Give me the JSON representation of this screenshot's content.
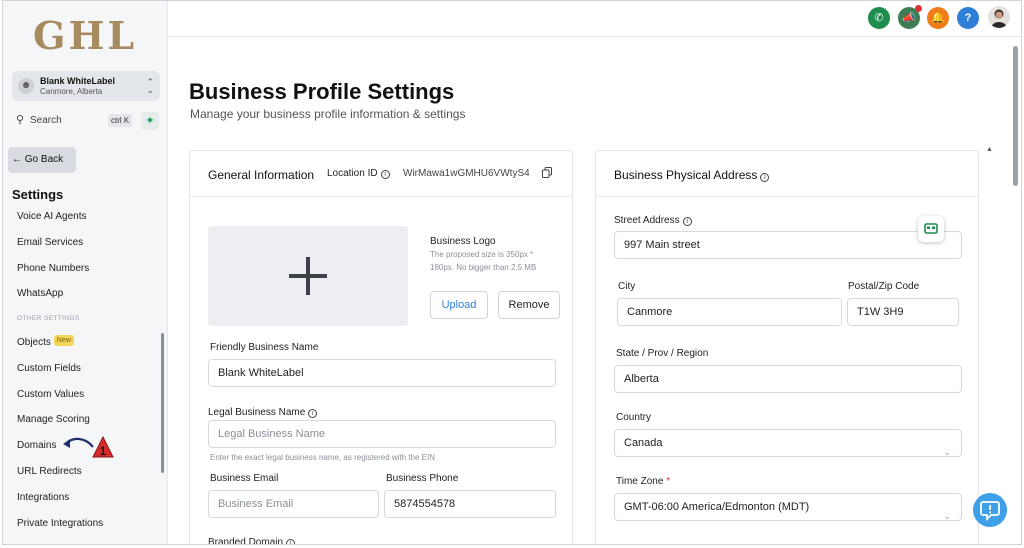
{
  "sidebar": {
    "logo_text": "GHL",
    "account": {
      "name": "Blank WhiteLabel",
      "location": "Canmore, Alberta"
    },
    "search": {
      "label": "Search",
      "shortcut": "ctrl K"
    },
    "go_back": "← Go Back",
    "settings_title": "Settings",
    "items": [
      "Voice AI Agents",
      "Email Services",
      "Phone Numbers",
      "WhatsApp"
    ],
    "other_section_label": "OTHER SETTINGS",
    "other_items": [
      {
        "label": "Objects",
        "badge": "New"
      },
      {
        "label": "Custom Fields"
      },
      {
        "label": "Custom Values"
      },
      {
        "label": "Manage Scoring"
      },
      {
        "label": "Domains"
      },
      {
        "label": "URL Redirects"
      },
      {
        "label": "Integrations"
      },
      {
        "label": "Private Integrations"
      }
    ],
    "callout_number": "1"
  },
  "topbar": {
    "icons": [
      "phone-icon",
      "megaphone-icon",
      "bell-icon",
      "help-icon",
      "user-avatar"
    ],
    "help_label": "?"
  },
  "page": {
    "title": "Business Profile Settings",
    "subtitle": "Manage your business profile information & settings"
  },
  "general": {
    "title": "General Information",
    "location_id_label": "Location ID",
    "location_id_value": "WirMawa1wGMHU6VWtyS4",
    "logo_label": "Business Logo",
    "logo_hint_1": "The proposed size is 350px *",
    "logo_hint_2": "180px. No bigger than 2.5 MB",
    "upload_button": "Upload",
    "remove_button": "Remove",
    "friendly_name_label": "Friendly Business Name",
    "friendly_name_value": "Blank WhiteLabel",
    "legal_name_label": "Legal Business Name",
    "legal_name_placeholder": "Legal Business Name",
    "legal_name_hint": "Enter the exact legal business name, as registered with the EIN",
    "email_label": "Business Email",
    "email_placeholder": "Business Email",
    "phone_label": "Business Phone",
    "phone_value": "5874554578",
    "branded_domain_label": "Branded Domain"
  },
  "address": {
    "title": "Business Physical Address",
    "street_label": "Street Address",
    "street_value": "997 Main street",
    "city_label": "City",
    "city_value": "Canmore",
    "postal_label": "Postal/Zip Code",
    "postal_value": "T1W 3H9",
    "state_label": "State / Prov / Region",
    "state_value": "Alberta",
    "country_label": "Country",
    "country_value": "Canada",
    "timezone_label": "Time Zone",
    "timezone_required": "*",
    "timezone_value": "GMT-06:00 America/Edmonton (MDT)"
  },
  "colors": {
    "brand_logo": "#a88a5f",
    "phone": "#1e8e4e",
    "megaphone": "#3f7d54",
    "bell": "#f07b18",
    "help": "#2f7ed8",
    "callout": "#d92b2b"
  }
}
